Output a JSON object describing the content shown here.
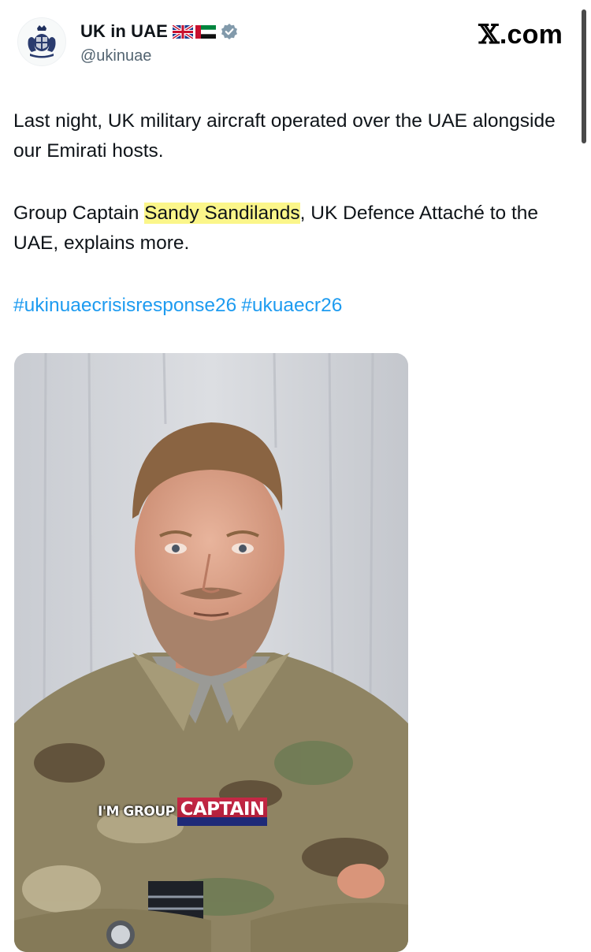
{
  "account": {
    "display_name": "UK in UAE",
    "handle": "@ukinuae",
    "flags": [
      "uk-flag-icon",
      "uae-flag-icon"
    ],
    "verified_color": "#829aab"
  },
  "brand": {
    "x_glyph": "𝕏",
    "site_suffix": ".com"
  },
  "post": {
    "paragraph1": "Last night, UK military aircraft operated over the UAE alongside our Emirati hosts.",
    "paragraph2_before": "Group Captain ",
    "paragraph2_highlight": "Sandy Sandilands",
    "paragraph2_after": ", UK Defence Attaché to the UAE, explains more.",
    "hashtags": [
      "#ukinuaecrisisresponse26",
      "#ukuaecr26"
    ],
    "link_color": "#1d9bf0",
    "highlight_color": "#fbf68a"
  },
  "video": {
    "caption_small": "I'M GROUP",
    "caption_big": "CAPTAIN"
  }
}
